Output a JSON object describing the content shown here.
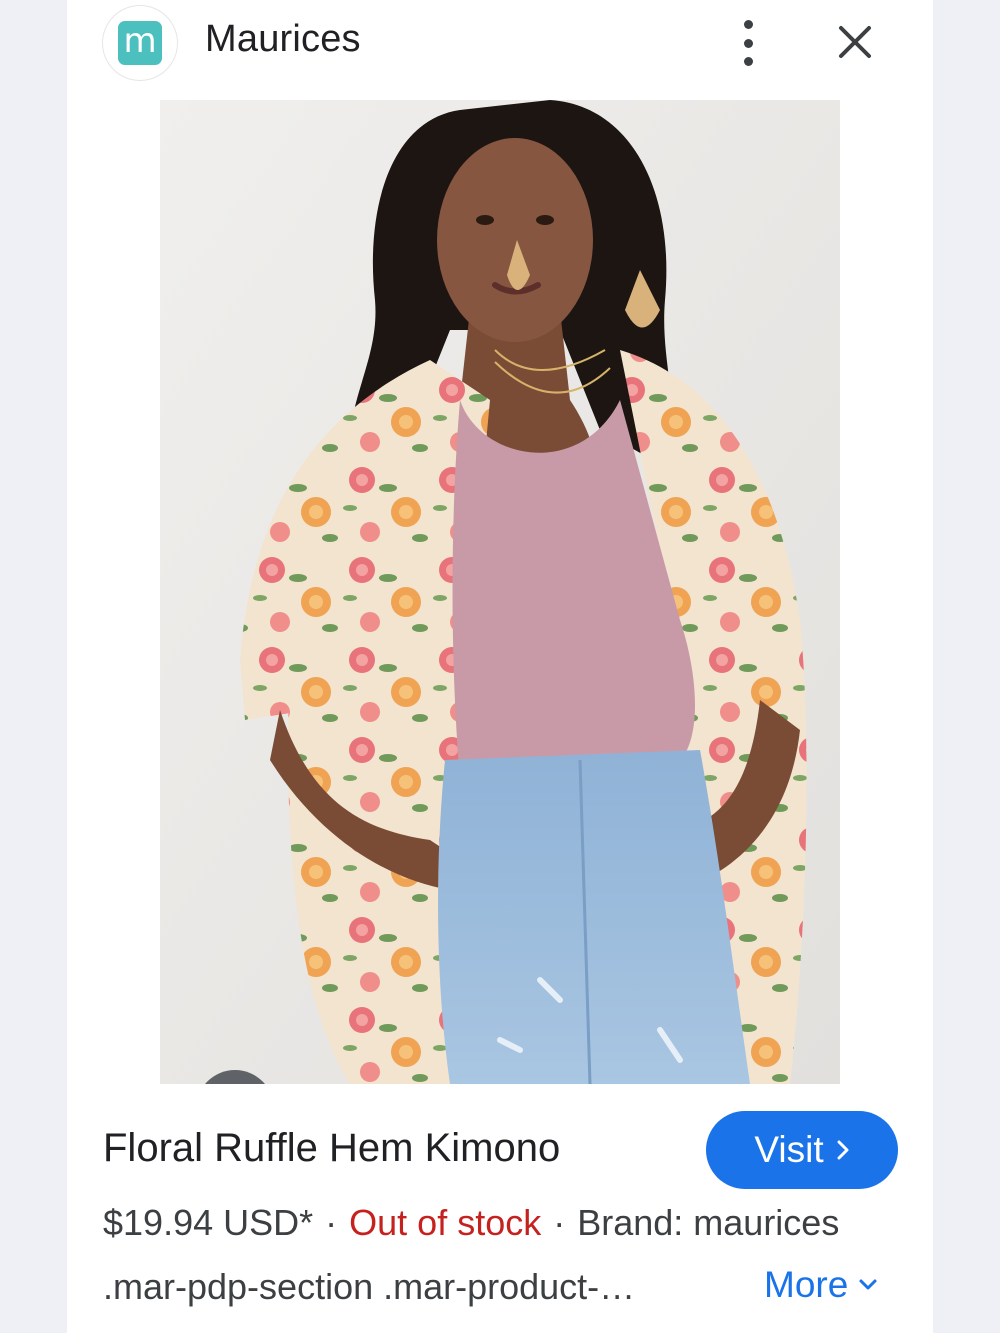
{
  "header": {
    "logo_letter": "m",
    "site_name": "Maurices",
    "menu_icon": "more-vert-icon",
    "close_icon": "close-icon"
  },
  "image": {
    "alt": "Floral Ruffle Hem Kimono",
    "lens_icon": "google-lens-icon"
  },
  "product": {
    "title": "Floral Ruffle Hem Kimono",
    "visit_label": "Visit",
    "price": "$19.94 USD*",
    "separator": "·",
    "stock": "Out of stock",
    "brand": "Brand: maurices",
    "snippet": ".mar-pdp-section .mar-product-…",
    "more_label": "More"
  },
  "colors": {
    "accent": "#1a73e8",
    "out_of_stock": "#c5221f",
    "logo": "#4cbfbf"
  }
}
